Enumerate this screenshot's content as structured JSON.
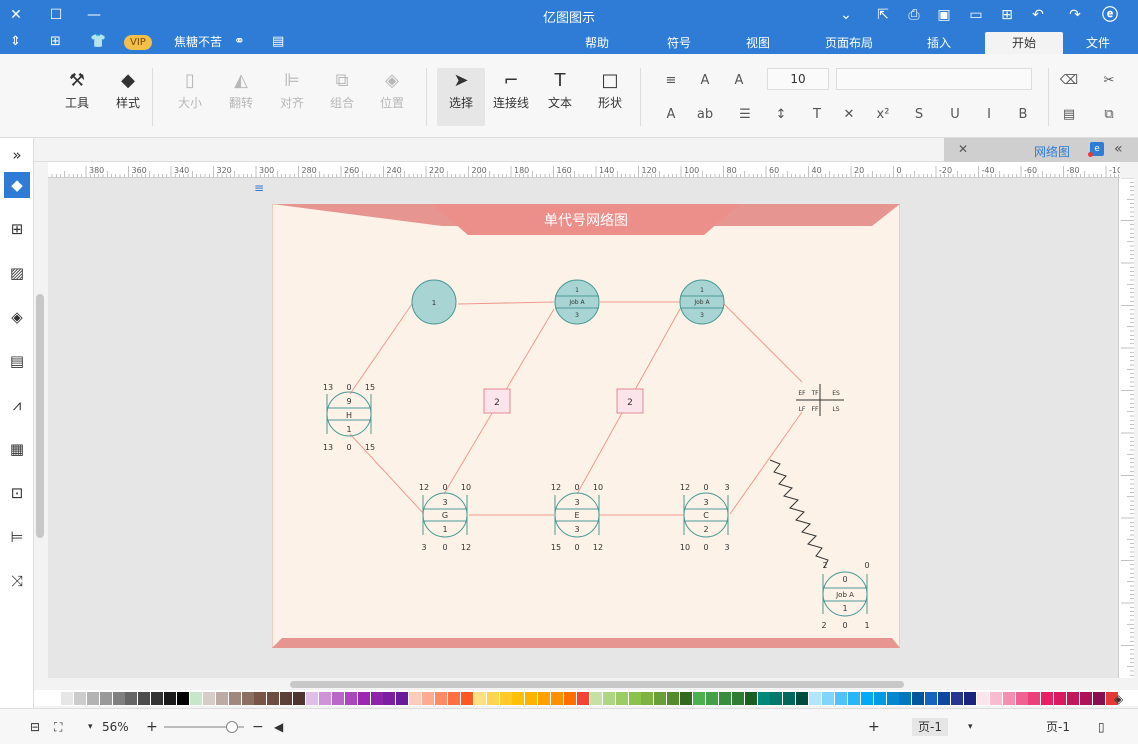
{
  "titlebar": {
    "title": "亿图图示"
  },
  "menubar": {
    "tabs": [
      {
        "label": "文件"
      },
      {
        "label": "开始"
      },
      {
        "label": "插入"
      },
      {
        "label": "页面布局"
      },
      {
        "label": "视图"
      },
      {
        "label": "符号"
      },
      {
        "label": "帮助"
      }
    ],
    "username": "焦糖不苦",
    "vip_label": "VIP"
  },
  "ribbon": {
    "tools": [
      {
        "label": "工具"
      },
      {
        "label": "样式"
      },
      {
        "label": "大小"
      },
      {
        "label": "翻转"
      },
      {
        "label": "对齐"
      },
      {
        "label": "组合"
      },
      {
        "label": "位置"
      },
      {
        "label": "选择"
      },
      {
        "label": "连接线"
      },
      {
        "label": "文本"
      },
      {
        "label": "形状"
      }
    ],
    "font_size": "10"
  },
  "document": {
    "tab_label": "网络图"
  },
  "diagram": {
    "title": "单代号网络图",
    "nodes_top": [
      {
        "top": "1",
        "mid": "",
        "bottom": ""
      },
      {
        "top": "1",
        "mid": "Job A",
        "bottom": "3"
      },
      {
        "top": "1",
        "mid": "Job A",
        "bottom": "3"
      }
    ],
    "node_h": {
      "left_top": "13",
      "l2": "0",
      "r2": "15",
      "r1": "",
      "name": "H",
      "a": "9",
      "b": "1",
      "bottom_left": "13",
      "bl2": "0",
      "br2": "15"
    },
    "legend": {
      "es": "ES",
      "tf": "TF",
      "ef": "EF",
      "ls": "LS",
      "ff": "FF",
      "lf": "LF"
    },
    "lag_boxes": [
      "2",
      "2"
    ],
    "bottom_nodes": [
      {
        "id": "G",
        "tl": "10",
        "tm": "0",
        "tr": "12",
        "name": "G",
        "top": "3",
        "bot": "1",
        "bl": "3",
        "bm": "0",
        "br": "12"
      },
      {
        "id": "E",
        "tl": "10",
        "tm": "0",
        "tr": "12",
        "name": "E",
        "top": "3",
        "bot": "3",
        "bl": "12",
        "bm": "0",
        "br": "15"
      },
      {
        "id": "C",
        "tl": "3",
        "tm": "0",
        "tr": "12",
        "name": "C",
        "top": "3",
        "bot": "2",
        "bl": "3",
        "bm": "0",
        "br": "10"
      }
    ],
    "job_a_bottom": {
      "tl": "0",
      "tr": "2",
      "top": "0",
      "name": "Job A",
      "bot": "1",
      "bl": "1",
      "bm": "0",
      "br": "2"
    }
  },
  "hruler": {
    "labels": [
      "380",
      "360",
      "340",
      "320",
      "300",
      "280",
      "260",
      "240",
      "220",
      "200",
      "180",
      "160",
      "140",
      "120",
      "100",
      "80",
      "60",
      "40",
      "20",
      "0",
      "-20",
      "-40",
      "-60",
      "-80",
      "-100"
    ]
  },
  "statusbar": {
    "page_label_left": "页-1",
    "page_label_right": "页-1",
    "add_icon": "+",
    "zoom": "56%"
  },
  "palette": {
    "colors": [
      "#ffffff",
      "#e6e6e6",
      "#cccccc",
      "#b3b3b3",
      "#999999",
      "#808080",
      "#666666",
      "#4d4d4d",
      "#333333",
      "#1a1a1a",
      "#000000",
      "#c8e6c9",
      "#d7ccc8",
      "#bcaaa4",
      "#a1887f",
      "#8d6e63",
      "#795548",
      "#6d4c41",
      "#5d4037",
      "#4e342e",
      "#e1bee7",
      "#ce93d8",
      "#ba68c8",
      "#ab47bc",
      "#9c27b0",
      "#8e24aa",
      "#7b1fa2",
      "#6a1b9a",
      "#ffccbc",
      "#ffab91",
      "#ff8a65",
      "#ff7043",
      "#ff5722",
      "#ffe082",
      "#ffd54f",
      "#ffca28",
      "#ffc107",
      "#ffb300",
      "#ffa000",
      "#ff8f00",
      "#ff6f00",
      "#f44336",
      "#c5e1a5",
      "#aed581",
      "#9ccc65",
      "#8bc34a",
      "#7cb342",
      "#689f38",
      "#558b2f",
      "#33691e",
      "#4caf50",
      "#43a047",
      "#388e3c",
      "#2e7d32",
      "#1b5e20",
      "#00897b",
      "#00796b",
      "#00695c",
      "#004d40",
      "#b3e5fc",
      "#81d4fa",
      "#4fc3f7",
      "#29b6f6",
      "#03a9f4",
      "#039be5",
      "#0288d1",
      "#0277bd",
      "#01579b",
      "#1565c0",
      "#0d47a1",
      "#283593",
      "#1a237e",
      "#fce4ec",
      "#f8bbd0",
      "#f48fb1",
      "#f06292",
      "#ec407a",
      "#e91e63",
      "#d81b60",
      "#c2185b",
      "#ad1457",
      "#880e4f",
      "#e53935"
    ]
  }
}
